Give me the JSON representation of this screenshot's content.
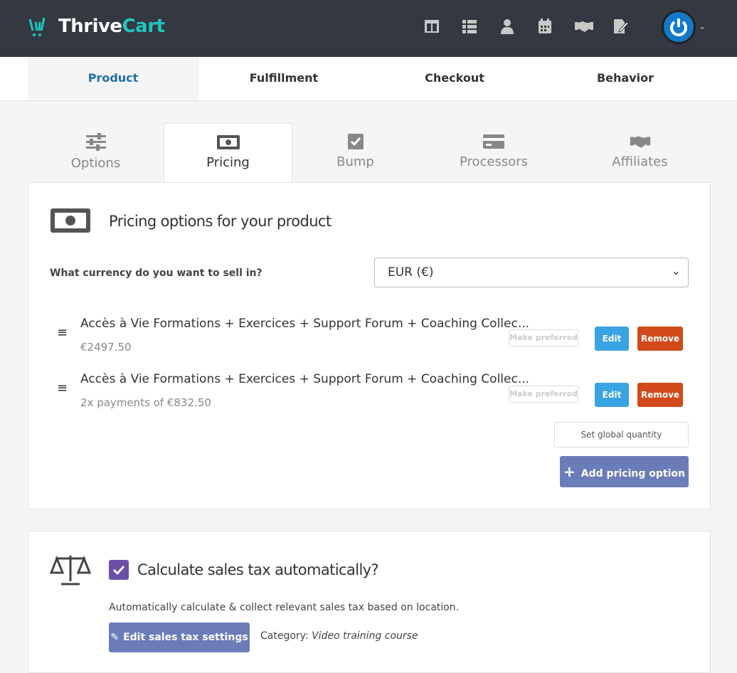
{
  "header": {
    "logo_text_a": "Thrive",
    "logo_text_b": "Cart",
    "nav_icons": [
      "layout-icon",
      "list-icon",
      "user-icon",
      "calendar-icon",
      "handshake-icon",
      "edit-document-icon"
    ],
    "avatar": "power-icon"
  },
  "main_tabs": [
    {
      "label": "Product",
      "active": true
    },
    {
      "label": "Fulfillment"
    },
    {
      "label": "Checkout"
    },
    {
      "label": "Behavior"
    }
  ],
  "sub_tabs": [
    {
      "label": "Options",
      "icon": "sliders-icon"
    },
    {
      "label": "Pricing",
      "icon": "money-icon",
      "active": true
    },
    {
      "label": "Bump",
      "icon": "checkbox-icon"
    },
    {
      "label": "Processors",
      "icon": "credit-card-icon"
    },
    {
      "label": "Affiliates",
      "icon": "handshake-icon"
    }
  ],
  "pricing": {
    "title": "Pricing options for your product",
    "currency_label": "What currency do you want to sell in?",
    "currency_value": "EUR (€)",
    "options": [
      {
        "title": "Accès à Vie Formations + Exercices + Support Forum + Coaching Collec...",
        "price": "€2497.50"
      },
      {
        "title": "Accès à Vie Formations + Exercices + Support Forum + Coaching Collec...",
        "price": "2x payments of €832.50"
      }
    ],
    "make_preferred": "Make preferred",
    "edit": "Edit",
    "remove": "Remove",
    "global_quantity": "Set global quantity",
    "add_option": "Add pricing option"
  },
  "tax": {
    "title": "Calculate sales tax automatically?",
    "checked": true,
    "description": "Automatically calculate & collect relevant sales tax based on location.",
    "edit_button": "Edit sales tax settings",
    "category_label": "Category:",
    "category_value": "Video training course"
  },
  "colors": {
    "header": "#343840",
    "accent": "#1e6fa8",
    "edit": "#3aa3e3",
    "remove": "#d14a19",
    "primary": "#6c7cb8",
    "checkbox": "#6b4fa8"
  }
}
